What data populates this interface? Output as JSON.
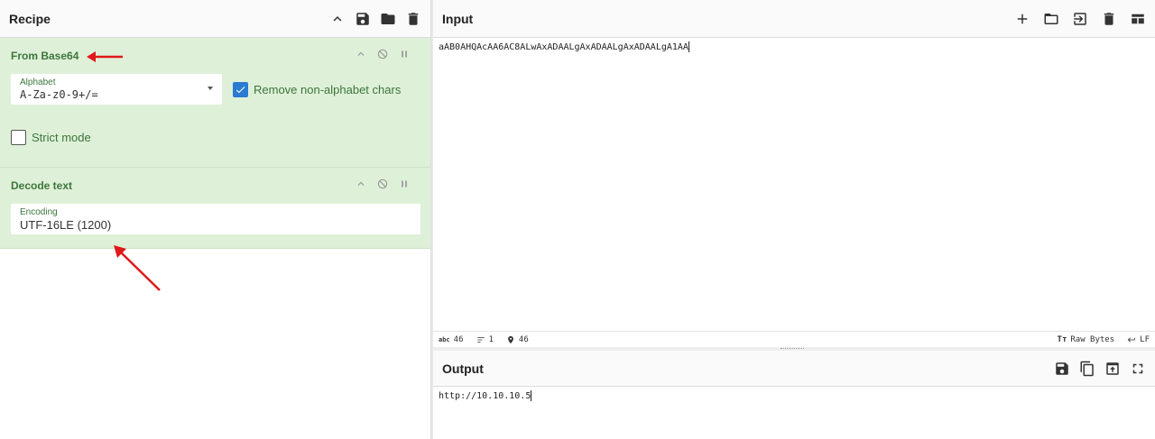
{
  "recipe": {
    "title": "Recipe",
    "icons": [
      "chevron-up-icon",
      "save-icon",
      "folder-icon",
      "trash-icon"
    ],
    "operations": [
      {
        "name": "From Base64",
        "alphabet_label": "Alphabet",
        "alphabet_value": "A-Za-z0-9+/=",
        "remove_nonalpha_label": "Remove non-alphabet chars",
        "remove_nonalpha_checked": true,
        "strict_mode_label": "Strict mode",
        "strict_mode_checked": false
      },
      {
        "name": "Decode text",
        "encoding_label": "Encoding",
        "encoding_value": "UTF-16LE (1200)"
      }
    ]
  },
  "input": {
    "title": "Input",
    "text": "aAB0AHQAcAA6AC8ALwAxADAALgAxADAALgAxADAALgA1AA",
    "status": {
      "chars": "46",
      "lines": "1",
      "position": "46",
      "raw_bytes_label": "Raw Bytes",
      "eol_label": "LF"
    }
  },
  "output": {
    "title": "Output",
    "text": "http://10.10.10.5"
  },
  "colors": {
    "op_bg": "#dff0d8",
    "op_text": "#3c763d",
    "checkbox_on": "#2a7bd1",
    "annotation_arrow": "#e0191b"
  }
}
